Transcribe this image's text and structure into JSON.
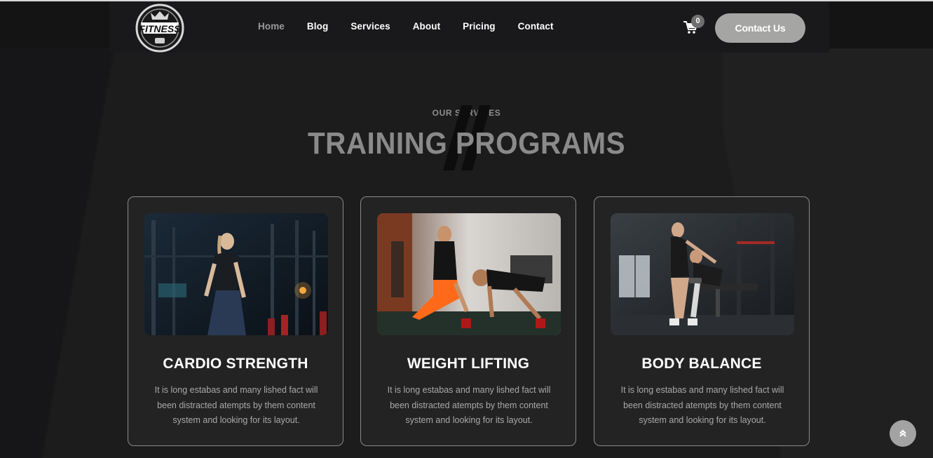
{
  "brand": {
    "logo_text": "FITNESS",
    "logo_subtext": "EXPERIENCE"
  },
  "nav": {
    "items": [
      {
        "label": "Home",
        "active": true
      },
      {
        "label": "Blog",
        "active": false
      },
      {
        "label": "Services",
        "active": false
      },
      {
        "label": "About",
        "active": false
      },
      {
        "label": "Pricing",
        "active": false
      },
      {
        "label": "Contact",
        "active": false
      }
    ],
    "cart_count": "0",
    "cta_label": "Contact Us"
  },
  "section": {
    "subheading": "OUR SERVICES",
    "heading": "TRAINING PROGRAMS"
  },
  "cards": [
    {
      "title": "CARDIO STRENGTH",
      "text": "It is long estabas and many lished fact will been distracted atempts by them content system and looking for its layout.",
      "image": "woman-cardio-photo"
    },
    {
      "title": "WEIGHT LIFTING",
      "text": "It is long estabas and many lished fact will been distracted atempts by them content system and looking for its layout.",
      "image": "trainer-pushup-photo"
    },
    {
      "title": "BODY BALANCE",
      "text": "It is long estabas and many lished fact will been distracted atempts by them content system and looking for its layout.",
      "image": "dumbbell-row-photo"
    }
  ],
  "colors": {
    "background": "#1c1c1d",
    "navbar": "#19191b",
    "accent": "#a5a5a3",
    "card_border": "#8a8a8a"
  },
  "icons": {
    "cart": "cart-icon",
    "scroll_top": "double-chevron-up-icon"
  }
}
